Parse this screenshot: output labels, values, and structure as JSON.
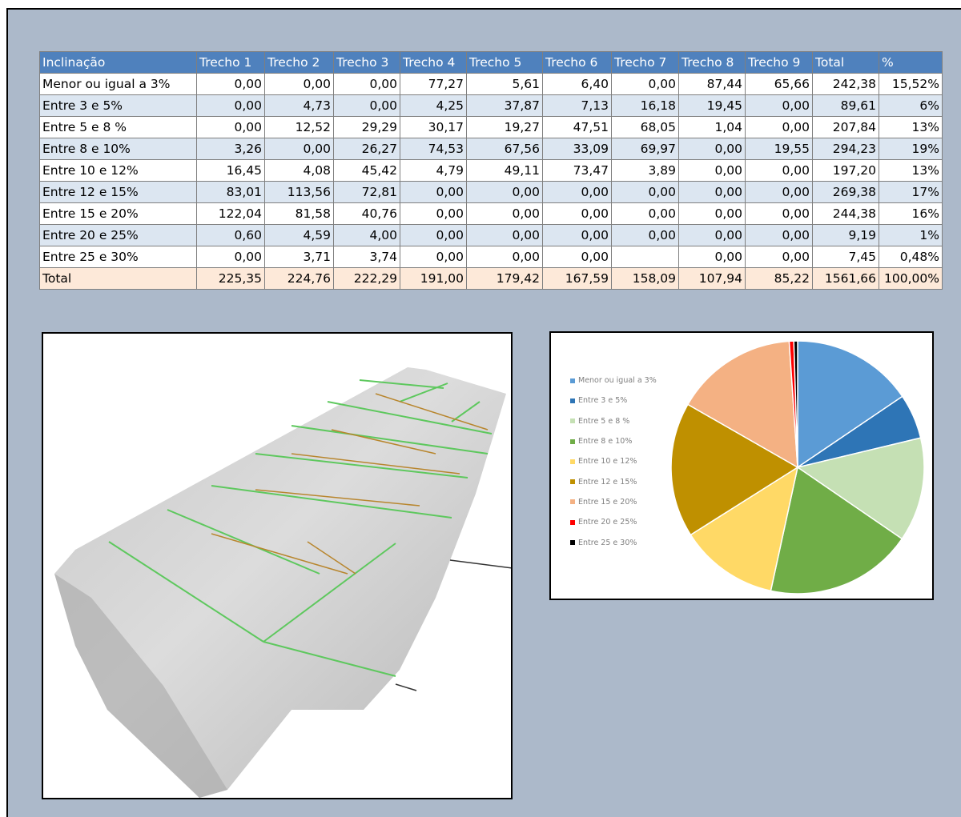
{
  "table": {
    "headers": [
      "Inclinação",
      "Trecho 1",
      "Trecho 2",
      "Trecho 3",
      "Trecho 4",
      "Trecho 5",
      "Trecho 6",
      "Trecho 7",
      "Trecho 8",
      "Trecho 9",
      "Total",
      "%"
    ],
    "rows": [
      {
        "label": "Menor ou igual a 3%",
        "cells": [
          "0,00",
          "0,00",
          "0,00",
          "77,27",
          "5,61",
          "6,40",
          "0,00",
          "87,44",
          "65,66",
          "242,38",
          "15,52%"
        ]
      },
      {
        "label": "Entre 3 e 5%",
        "cells": [
          "0,00",
          "4,73",
          "0,00",
          "4,25",
          "37,87",
          "7,13",
          "16,18",
          "19,45",
          "0,00",
          "89,61",
          "6%"
        ]
      },
      {
        "label": "Entre 5 e 8 %",
        "cells": [
          "0,00",
          "12,52",
          "29,29",
          "30,17",
          "19,27",
          "47,51",
          "68,05",
          "1,04",
          "0,00",
          "207,84",
          "13%"
        ]
      },
      {
        "label": "Entre 8 e 10%",
        "cells": [
          "3,26",
          "0,00",
          "26,27",
          "74,53",
          "67,56",
          "33,09",
          "69,97",
          "0,00",
          "19,55",
          "294,23",
          "19%"
        ]
      },
      {
        "label": "Entre 10 e 12%",
        "cells": [
          "16,45",
          "4,08",
          "45,42",
          "4,79",
          "49,11",
          "73,47",
          "3,89",
          "0,00",
          "0,00",
          "197,20",
          "13%"
        ]
      },
      {
        "label": "Entre 12 e 15%",
        "cells": [
          "83,01",
          "113,56",
          "72,81",
          "0,00",
          "0,00",
          "0,00",
          "0,00",
          "0,00",
          "0,00",
          "269,38",
          "17%"
        ]
      },
      {
        "label": "Entre 15 e 20%",
        "cells": [
          "122,04",
          "81,58",
          "40,76",
          "0,00",
          "0,00",
          "0,00",
          "0,00",
          "0,00",
          "0,00",
          "244,38",
          "16%"
        ]
      },
      {
        "label": "Entre 20 e 25%",
        "cells": [
          "0,60",
          "4,59",
          "4,00",
          "0,00",
          "0,00",
          "0,00",
          "0,00",
          "0,00",
          "0,00",
          "9,19",
          "1%"
        ]
      },
      {
        "label": "Entre 25 e 30%",
        "cells": [
          "0,00",
          "3,71",
          "3,74",
          "0,00",
          "0,00",
          "0,00",
          "",
          "0,00",
          "0,00",
          "7,45",
          "0,48%"
        ]
      }
    ],
    "total": {
      "label": "Total",
      "cells": [
        "225,35",
        "224,76",
        "222,29",
        "191,00",
        "179,42",
        "167,59",
        "158,09",
        "107,94",
        "85,22",
        "1561,66",
        "100,00%"
      ]
    }
  },
  "chart_data": {
    "type": "pie",
    "categories": [
      "Menor ou igual a 3%",
      "Entre 3 e 5%",
      "Entre 5 e 8 %",
      "Entre 8 e 10%",
      "Entre 10 e 12%",
      "Entre 12 e 15%",
      "Entre 15 e 20%",
      "Entre 20 e 25%",
      "Entre 25 e 30%"
    ],
    "values": [
      242.38,
      89.61,
      207.84,
      294.23,
      197.2,
      269.38,
      244.38,
      9.19,
      7.45
    ],
    "colors": [
      "#5b9bd5",
      "#2e75b6",
      "#c5e0b4",
      "#70ad47",
      "#ffd966",
      "#bf9000",
      "#f4b183",
      "#ff0000",
      "#000000"
    ],
    "legend": "left",
    "title": ""
  },
  "terrain": {
    "description_icon": "terrain-3d-surface"
  }
}
